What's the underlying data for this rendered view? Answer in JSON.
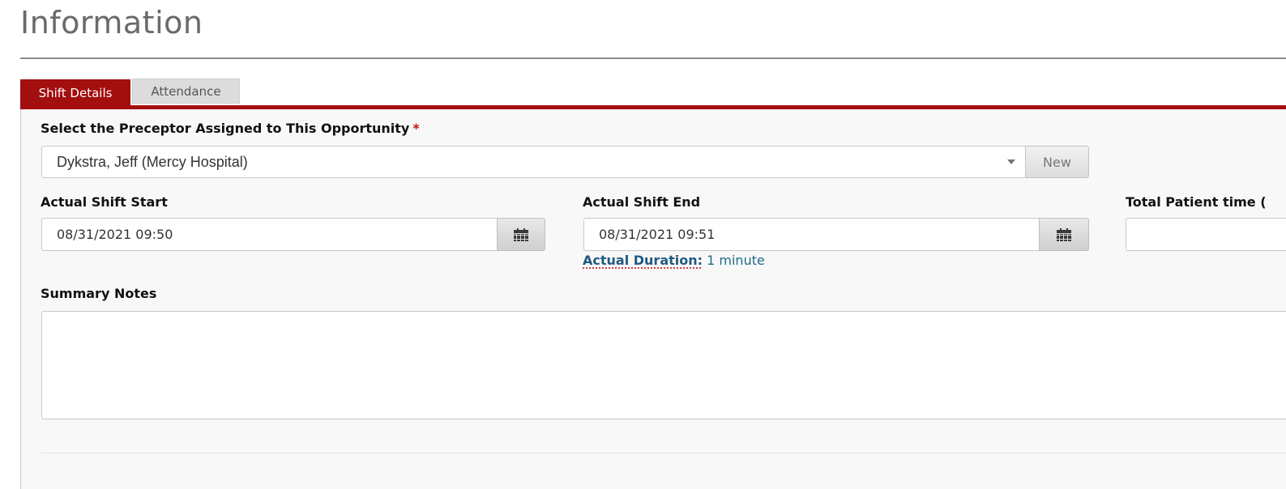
{
  "page": {
    "title": "Information"
  },
  "tabs": [
    {
      "label": "Shift Details",
      "active": true
    },
    {
      "label": "Attendance",
      "active": false
    }
  ],
  "colors": {
    "accent": "#a30e0e",
    "required": "#c0141a",
    "link": "#1f6a8a"
  },
  "preceptor": {
    "label": "Select the Preceptor Assigned to This Opportunity",
    "required_mark": "*",
    "selected": "Dykstra, Jeff (Mercy Hospital)",
    "new_button": "New"
  },
  "shift_start": {
    "label": "Actual Shift Start",
    "value": "08/31/2021 09:50",
    "icon": "calendar-icon"
  },
  "shift_end": {
    "label": "Actual Shift End",
    "value": "08/31/2021 09:51",
    "icon": "calendar-icon"
  },
  "duration": {
    "label": "Actual Duration:",
    "value": "1 minute"
  },
  "patient_time": {
    "label": "Total Patient time (",
    "value": ""
  },
  "summary": {
    "label": "Summary Notes",
    "value": ""
  }
}
